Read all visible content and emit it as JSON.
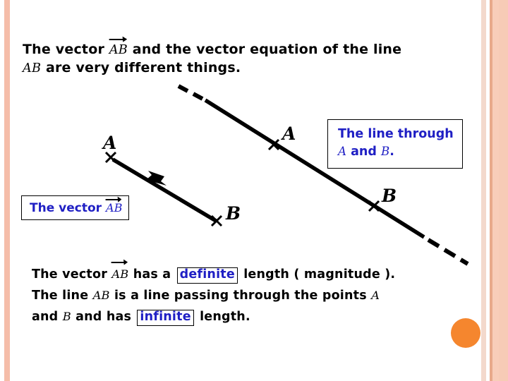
{
  "slide": {
    "intro": {
      "line1_pre": "The vector ",
      "line1_vec": "AB",
      "line1_post": " and the vector equation of the line",
      "line2_math": "AB",
      "line2_post": " are very different things."
    },
    "callouts": {
      "vector_box": {
        "text_pre": "The vector ",
        "math": "AB"
      },
      "line_box": {
        "line1": "The line through",
        "line2_a": "A",
        "line2_mid": " and ",
        "line2_b": "B",
        "line2_end": "."
      }
    },
    "figure": {
      "vector_point_a_label": "A",
      "vector_point_b_label": "B",
      "line_point_a_label": "A",
      "line_point_b_label": "B"
    },
    "bottom": {
      "l1_pre": "The vector ",
      "l1_vec": "AB",
      "l1_mid": "  has a ",
      "l1_hl": "definite",
      "l1_post": " length ( magnitude ).",
      "l2_pre": "The line ",
      "l2_math": "AB",
      "l2_post": " is a line passing through the points ",
      "l2_end_math": "A",
      "l3_pre": "and ",
      "l3_math": "B",
      "l3_mid": " and has ",
      "l3_hl": "infinite",
      "l3_post": " length."
    },
    "colors": {
      "accent_blue": "#1f1fc4",
      "ink_black": "#000000",
      "stripe_pink": "#f5bda9",
      "stripe_pink_dark": "#e8a98a",
      "dot_orange": "#f5862e",
      "background": "#ffffff"
    }
  }
}
